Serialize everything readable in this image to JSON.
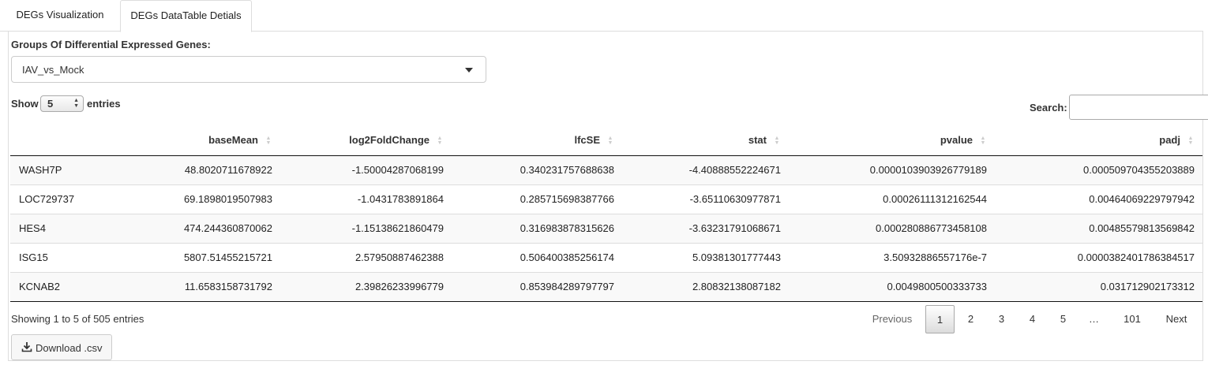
{
  "tabs": [
    {
      "label": "DEGs Visualization",
      "active": false
    },
    {
      "label": "DEGs DataTable Detials",
      "active": true
    }
  ],
  "group_select": {
    "label": "Groups Of Differential Expressed Genes:",
    "value": "IAV_vs_Mock"
  },
  "length": {
    "prefix": "Show",
    "value": "5",
    "suffix": "entries"
  },
  "search": {
    "label": "Search:",
    "value": ""
  },
  "table": {
    "columns": [
      "",
      "baseMean",
      "log2FoldChange",
      "lfcSE",
      "stat",
      "pvalue",
      "padj"
    ],
    "rows": [
      [
        "WASH7P",
        "48.8020711678922",
        "-1.50004287068199",
        "0.340231757688638",
        "-4.40888552224671",
        "0.0000103903926779189",
        "0.000509704355203889"
      ],
      [
        "LOC729737",
        "69.1898019507983",
        "-1.0431783891864",
        "0.285715698387766",
        "-3.65110630977871",
        "0.00026111312162544",
        "0.00464069229797942"
      ],
      [
        "HES4",
        "474.244360870062",
        "-1.15138621860479",
        "0.316983878315626",
        "-3.63231791068671",
        "0.000280886773458108",
        "0.00485579813569842"
      ],
      [
        "ISG15",
        "5807.51455215721",
        "2.57950887462388",
        "0.506400385256174",
        "5.09381301777443",
        "3.50932886557176e-7",
        "0.0000382401786384517"
      ],
      [
        "KCNAB2",
        "11.6583158731792",
        "2.39826233996779",
        "0.853984289797797",
        "2.80832138087182",
        "0.0049800500333733",
        "0.031712902173312"
      ]
    ]
  },
  "info": "Showing 1 to 5 of 505 entries",
  "pagination": {
    "previous": "Previous",
    "pages": [
      "1",
      "2",
      "3",
      "4",
      "5",
      "…",
      "101"
    ],
    "current": "1",
    "next": "Next"
  },
  "download": {
    "label": "Download .csv",
    "icon": "download-icon"
  }
}
